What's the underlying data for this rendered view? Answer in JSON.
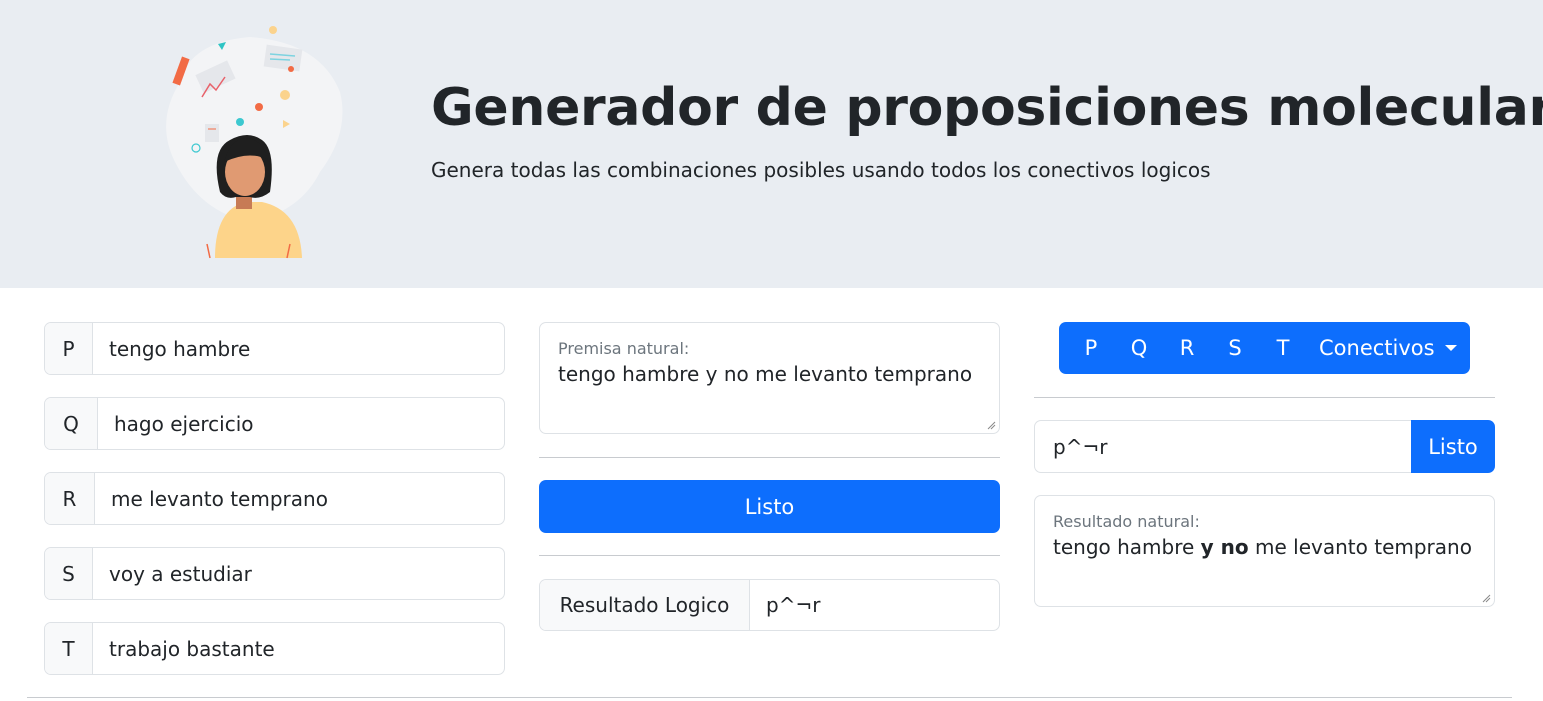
{
  "header": {
    "title": "Generador de proposiciones moleculares",
    "subtitle": "Genera todas las combinaciones posibles usando todos los conectivos logicos"
  },
  "variables": [
    {
      "letter": "P",
      "value": "tengo hambre"
    },
    {
      "letter": "Q",
      "value": "hago ejercicio"
    },
    {
      "letter": "R",
      "value": "me levanto temprano"
    },
    {
      "letter": "S",
      "value": "voy a estudiar"
    },
    {
      "letter": "T",
      "value": "trabajo bastante"
    }
  ],
  "premise": {
    "label": "Premisa natural:",
    "value": "tengo hambre y no me levanto temprano"
  },
  "listo_button": "Listo",
  "logical_result": {
    "label": "Resultado Logico",
    "value": "p^¬r"
  },
  "builder": {
    "buttons": [
      "P",
      "Q",
      "R",
      "S",
      "T"
    ],
    "dropdown_label": "Conectivos",
    "formula_value": "p^¬r",
    "formula_button": "Listo"
  },
  "natural_result": {
    "label": "Resultado natural:",
    "parts": [
      "tengo hambre ",
      "y no",
      " me levanto temprano"
    ]
  },
  "colors": {
    "primary": "#0d6efd",
    "hero_bg": "#e9edf2"
  }
}
